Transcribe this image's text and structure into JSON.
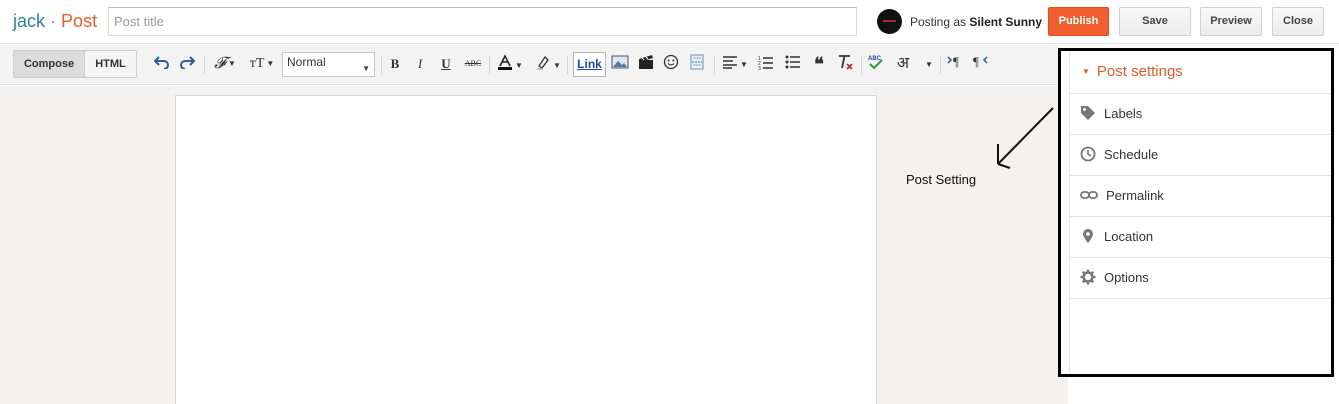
{
  "header": {
    "blog_name": "jack",
    "separator": "·",
    "section": "Post",
    "title_placeholder": "Post title",
    "posting_as_prefix": "Posting as",
    "user_name": "Silent Sunny",
    "publish_label": "Publish",
    "save_label": "Save",
    "preview_label": "Preview",
    "close_label": "Close"
  },
  "toolbar": {
    "compose_label": "Compose",
    "html_label": "HTML",
    "format_select": "Normal",
    "link_label": "Link",
    "bold": "B",
    "italic": "I",
    "underline": "U",
    "strike": "ABC",
    "hindi": "अ",
    "icons": [
      "undo-icon",
      "redo-icon",
      "font-family-icon",
      "font-size-icon",
      "bold-icon",
      "italic-icon",
      "underline-icon",
      "strikethrough-icon",
      "text-color-icon",
      "highlight-icon",
      "link",
      "image-icon",
      "video-icon",
      "emoticon-icon",
      "jump-break-icon",
      "align-icon",
      "numbered-list-icon",
      "bulleted-list-icon",
      "quote-icon",
      "clear-format-icon",
      "spellcheck-icon",
      "transliteration-icon",
      "ltr-icon",
      "rtl-icon"
    ]
  },
  "annotation": {
    "text": "Post Setting"
  },
  "post_settings": {
    "title": "Post settings",
    "items": [
      {
        "label": "Labels",
        "icon": "tag-icon"
      },
      {
        "label": "Schedule",
        "icon": "clock-icon"
      },
      {
        "label": "Permalink",
        "icon": "link-icon"
      },
      {
        "label": "Location",
        "icon": "location-pin-icon"
      },
      {
        "label": "Options",
        "icon": "gear-icon"
      }
    ]
  },
  "colors": {
    "accent_orange": "#f25f2e",
    "blog_blue": "#2f7fa3",
    "link_blue": "#1a4fa3"
  }
}
